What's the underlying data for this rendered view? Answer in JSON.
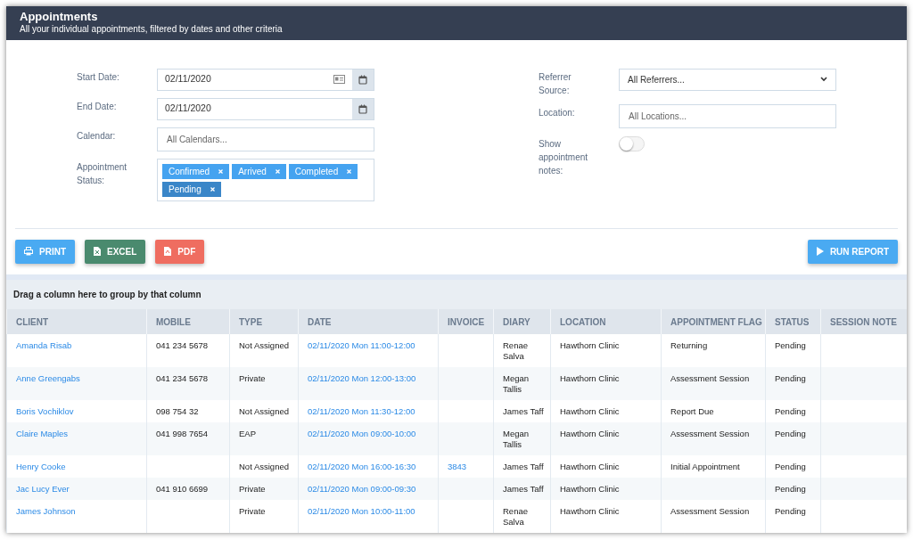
{
  "header": {
    "title": "Appointments",
    "subtitle": "All your individual appointments, filtered by dates and other criteria"
  },
  "filters_left": [
    {
      "kind": "date",
      "label": "Start Date:",
      "value": "02/11/2020",
      "extra_icon": true
    },
    {
      "kind": "date",
      "label": "End Date:",
      "value": "02/11/2020",
      "extra_icon": false
    },
    {
      "kind": "text",
      "label": "Calendar:",
      "placeholder": "All Calendars..."
    },
    {
      "kind": "tags",
      "label": "Appointment Status:",
      "tags": [
        {
          "label": "Confirmed",
          "highlighted": false
        },
        {
          "label": "Arrived",
          "highlighted": false
        },
        {
          "label": "Completed",
          "highlighted": false
        },
        {
          "label": "Pending",
          "highlighted": true
        }
      ]
    }
  ],
  "filters_right": [
    {
      "kind": "select",
      "label": "Referrer Source:",
      "value": "All Referrers..."
    },
    {
      "kind": "text",
      "label": "Location:",
      "placeholder": "All Locations..."
    },
    {
      "kind": "toggle",
      "label": "Show appointment notes:",
      "on": false
    }
  ],
  "buttons": [
    {
      "kind": "print",
      "label": "PRINT"
    },
    {
      "kind": "excel",
      "label": "EXCEL"
    },
    {
      "kind": "pdf",
      "label": "PDF"
    },
    {
      "kind": "run",
      "label": "RUN REPORT"
    }
  ],
  "group_hint": "Drag a column here to group by that column",
  "table": {
    "columns": [
      "CLIENT",
      "MOBILE",
      "TYPE",
      "DATE",
      "INVOICE",
      "DIARY",
      "LOCATION",
      "APPOINTMENT FLAG",
      "STATUS",
      "SESSION NOTE"
    ],
    "rows": [
      [
        "Amanda Risab",
        "041 234 5678",
        "Not Assigned",
        "02/11/2020 Mon 11:00-12:00",
        "",
        "Renae Salva",
        "Hawthorn Clinic",
        "Returning",
        "Pending",
        ""
      ],
      [
        "Anne Greengabs",
        "041 234 5678",
        "Private",
        "02/11/2020 Mon 12:00-13:00",
        "",
        "Megan Tallis",
        "Hawthorn Clinic",
        "Assessment Session",
        "Pending",
        ""
      ],
      [
        "Boris Vochiklov",
        "098 754 32",
        "Not Assigned",
        "02/11/2020 Mon 11:30-12:00",
        "",
        "James Taff",
        "Hawthorn Clinic",
        "Report Due",
        "Pending",
        ""
      ],
      [
        "Claire Maples",
        "041 998 7654",
        "EAP",
        "02/11/2020 Mon 09:00-10:00",
        "",
        "Megan Tallis",
        "Hawthorn Clinic",
        "Assessment Session",
        "Pending",
        ""
      ],
      [
        "Henry Cooke",
        "",
        "Not Assigned",
        "02/11/2020 Mon 16:00-16:30",
        "3843",
        "James Taff",
        "Hawthorn Clinic",
        "Initial Appointment",
        "Pending",
        ""
      ],
      [
        "Jac Lucy Ever",
        "041 910 6699",
        "Private",
        "02/11/2020 Mon 09:00-09:30",
        "",
        "James Taff",
        "Hawthorn Clinic",
        "",
        "Pending",
        ""
      ],
      [
        "James Johnson",
        "",
        "Private",
        "02/11/2020 Mon 10:00-11:00",
        "",
        "Renae Salva",
        "Hawthorn Clinic",
        "Assessment Session",
        "Pending",
        ""
      ]
    ]
  }
}
